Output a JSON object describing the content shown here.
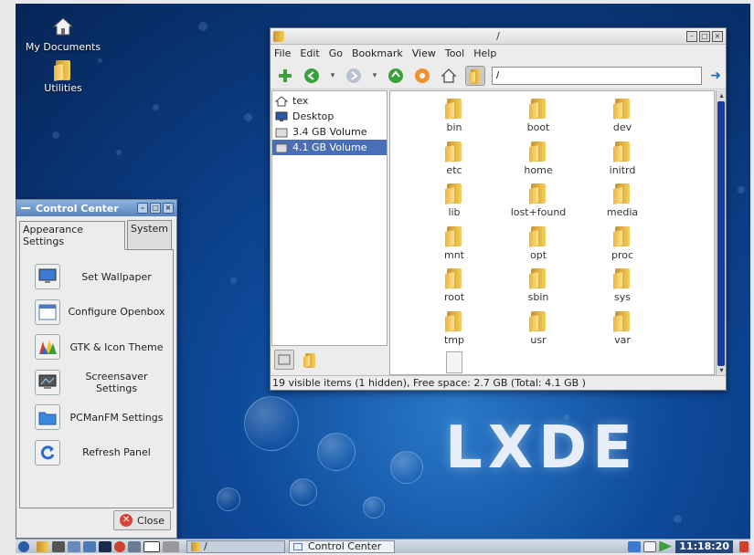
{
  "desktop": {
    "icons": [
      {
        "label": "My Documents",
        "icon": "home-icon"
      },
      {
        "label": "Utilities",
        "icon": "folder-icon"
      }
    ],
    "logo_text": "LXDE"
  },
  "file_manager": {
    "title": "/",
    "menu": [
      "File",
      "Edit",
      "Go",
      "Bookmark",
      "View",
      "Tool",
      "Help"
    ],
    "path_value": "/",
    "sidebar": [
      {
        "label": "tex",
        "icon": "home-icon"
      },
      {
        "label": "Desktop",
        "icon": "desktop-icon"
      },
      {
        "label": "3.4 GB Volume",
        "icon": "drive-icon"
      },
      {
        "label": "4.1 GB Volume",
        "icon": "drive-icon",
        "selected": true
      }
    ],
    "files": [
      "bin",
      "boot",
      "dev",
      "etc",
      "home",
      "initrd",
      "lib",
      "lost+found",
      "media",
      "mnt",
      "opt",
      "proc",
      "root",
      "sbin",
      "sys",
      "tmp",
      "usr",
      "var",
      ""
    ],
    "status": "19 visible items (1 hidden), Free space: 2.7 GB (Total: 4.1 GB )"
  },
  "control_center": {
    "title": "Control Center",
    "tabs": [
      "Appearance Settings",
      "System"
    ],
    "items": [
      {
        "label": "Set Wallpaper",
        "icon": "wallpaper-icon"
      },
      {
        "label": "Configure Openbox",
        "icon": "openbox-icon"
      },
      {
        "label": "GTK & Icon Theme",
        "icon": "theme-icon"
      },
      {
        "label": "Screensaver Settings",
        "icon": "screensaver-icon"
      },
      {
        "label": "PCManFM Settings",
        "icon": "pcmanfm-icon"
      },
      {
        "label": "Refresh Panel",
        "icon": "refresh-icon"
      }
    ],
    "close_label": "Close"
  },
  "taskbar": {
    "tasks": [
      {
        "label": "/",
        "active": true
      },
      {
        "label": "Control Center",
        "active": false
      }
    ],
    "clock": "11:18:20"
  }
}
